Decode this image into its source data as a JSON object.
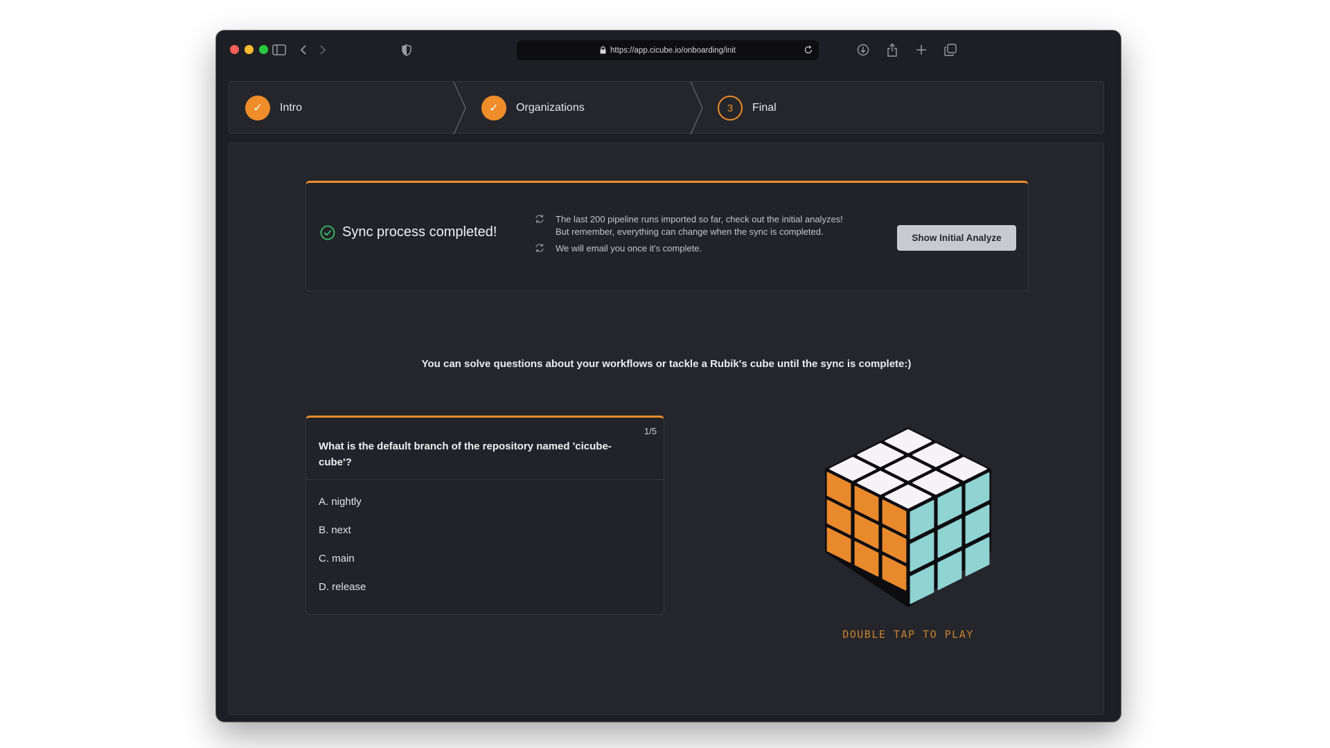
{
  "browser": {
    "url": "https://app.cicube.io/onboarding/init"
  },
  "stepper": {
    "steps": [
      {
        "label": "Intro",
        "marker": "✓",
        "state": "done"
      },
      {
        "label": "Organizations",
        "marker": "✓",
        "state": "done"
      },
      {
        "label": "Final",
        "marker": "3",
        "state": "current"
      }
    ]
  },
  "sync": {
    "title": "Sync process completed!",
    "message_1_line_1": "The last 200 pipeline runs imported so far, check out the initial analyzes!",
    "message_1_line_2": "But remember, everything can change when the sync is completed.",
    "message_2": "We will email you once it's complete.",
    "button_label": "Show Initial Analyze"
  },
  "prompt": "You can solve questions about your workflows or tackle a Rubik's cube until the sync is complete:)",
  "quiz": {
    "counter": "1/5",
    "question": "What is the default branch of the repository named 'cicube-cube'?",
    "options": [
      "A. nightly",
      "B. next",
      "C. main",
      "D. release"
    ]
  },
  "cube": {
    "play_label": "DOUBLE TAP TO PLAY",
    "face_colors": {
      "top": "#f6f3f7",
      "left": "#e8892c",
      "right": "#8fd3d2"
    }
  },
  "colors": {
    "accent": "#f08d2b",
    "success": "#3fbf6f"
  }
}
